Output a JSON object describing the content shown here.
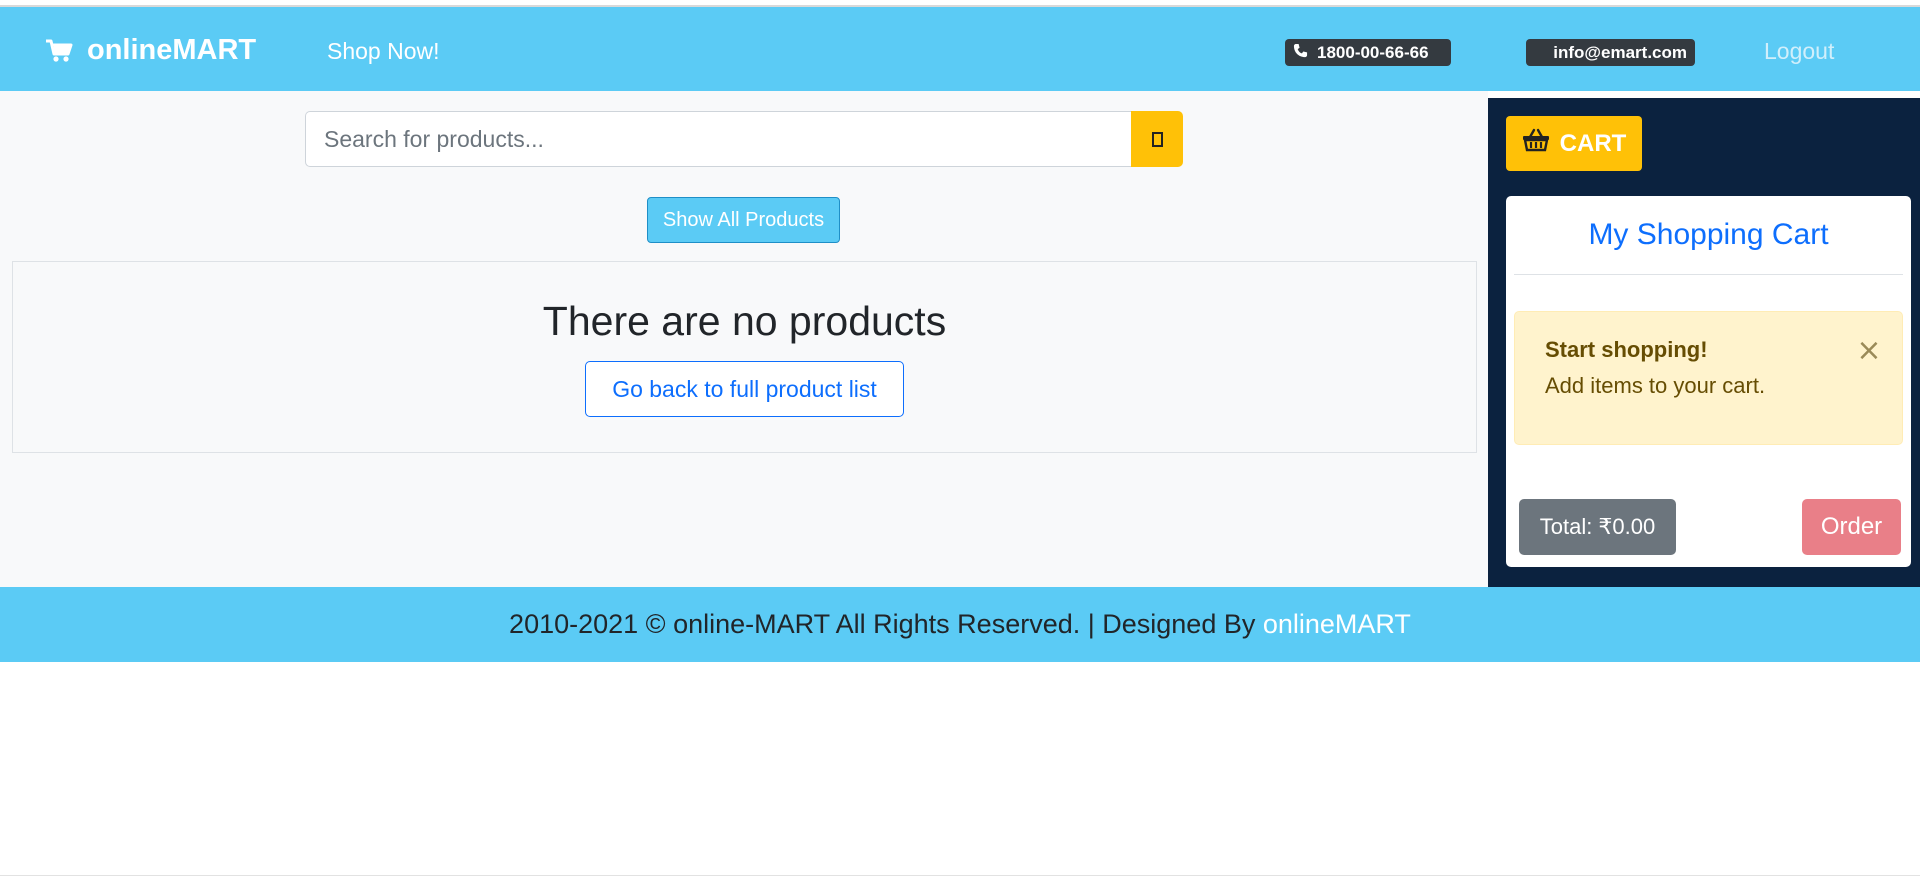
{
  "navbar": {
    "brand": "onlineMART",
    "shop_link": "Shop Now!",
    "phone": "1800-00-66-66",
    "email": "info@emart.com",
    "logout": "Logout",
    "color": "#5bcbf5"
  },
  "search": {
    "placeholder": "Search for products...",
    "value": ""
  },
  "main": {
    "show_all_label": "Show All Products",
    "empty_title": "There are no products",
    "back_label": "Go back to full product list"
  },
  "cart": {
    "button_label": "CART",
    "title": "My Shopping Cart",
    "alert_strong": "Start shopping!",
    "alert_text": "Add items to your cart.",
    "alert_close": "×",
    "total_label": "Total: ₹0.00",
    "order_label": "Order",
    "panel_color": "#0b223f",
    "accent_color": "#ffc107"
  },
  "footer": {
    "text": "2010-2021 © online-MART All Rights Reserved. | Designed By ",
    "link": "onlineMART"
  },
  "icons": {
    "brand": "shopping-cart-icon",
    "phone": "phone-icon",
    "search": "search-icon",
    "cart": "basket-icon",
    "close": "close-icon"
  }
}
